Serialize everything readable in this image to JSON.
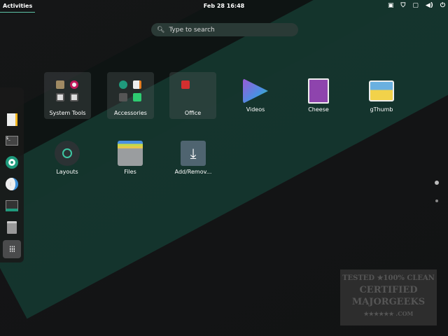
{
  "topbar": {
    "activities": "Activities",
    "clock": "Feb 28  16:48",
    "tray_icons": [
      "display-icon",
      "shield-icon",
      "screen-icon",
      "volume-icon",
      "power-icon"
    ]
  },
  "search": {
    "placeholder": "Type to search"
  },
  "dock": {
    "items": [
      "files",
      "text-editor",
      "terminal",
      "software",
      "disc-utility",
      "installer",
      "trash",
      "show-apps"
    ]
  },
  "folders": [
    {
      "label": "System Tools"
    },
    {
      "label": "Accessories"
    },
    {
      "label": "Office"
    }
  ],
  "apps": [
    {
      "label": "Videos"
    },
    {
      "label": "Cheese"
    },
    {
      "label": "gThumb"
    },
    {
      "label": "Layouts"
    },
    {
      "label": "Files"
    },
    {
      "label": "Add/Remov..."
    }
  ],
  "watermark": {
    "line1": "TESTED ★100% CLEAN",
    "line2": "CERTIFIED",
    "line3": "MAJORGEEKS",
    "line4": "★★★★★★ .COM"
  }
}
